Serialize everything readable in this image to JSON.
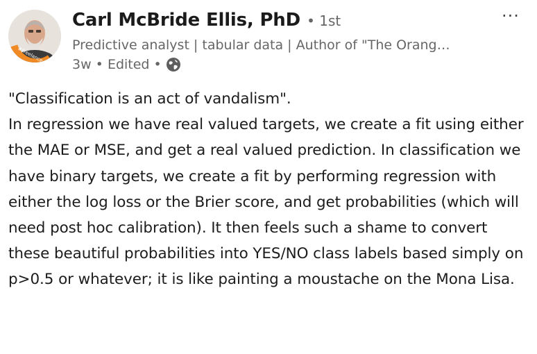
{
  "author": {
    "name": "Carl McBride Ellis, PhD",
    "degree": "• 1st",
    "headline": "Predictive analyst | tabular data | Author of \"The Orang…",
    "avatar_badge": "#Freelance"
  },
  "meta": {
    "time": "3w",
    "separator1": " • ",
    "edited": "Edited",
    "separator2": " •",
    "visibility_icon": "globe-icon"
  },
  "menu": {
    "more_label": "···"
  },
  "post": {
    "quote": "\"Classification is an act of vandalism\".",
    "paragraph": "In regression we have real valued targets, we create a fit using either the MAE or MSE, and get a real valued prediction. In classification we have binary targets, we create a fit by performing regression with either the log loss or the Brier score, and get probabilities (which will need post hoc calibration). It then feels such a shame to convert these beautiful probabilities into YES/NO class labels based simply on p>0.5 or whatever; it is like painting a moustache on the Mona Lisa."
  },
  "colors": {
    "badge": "#f08a24",
    "secondary_text": "#666666"
  }
}
